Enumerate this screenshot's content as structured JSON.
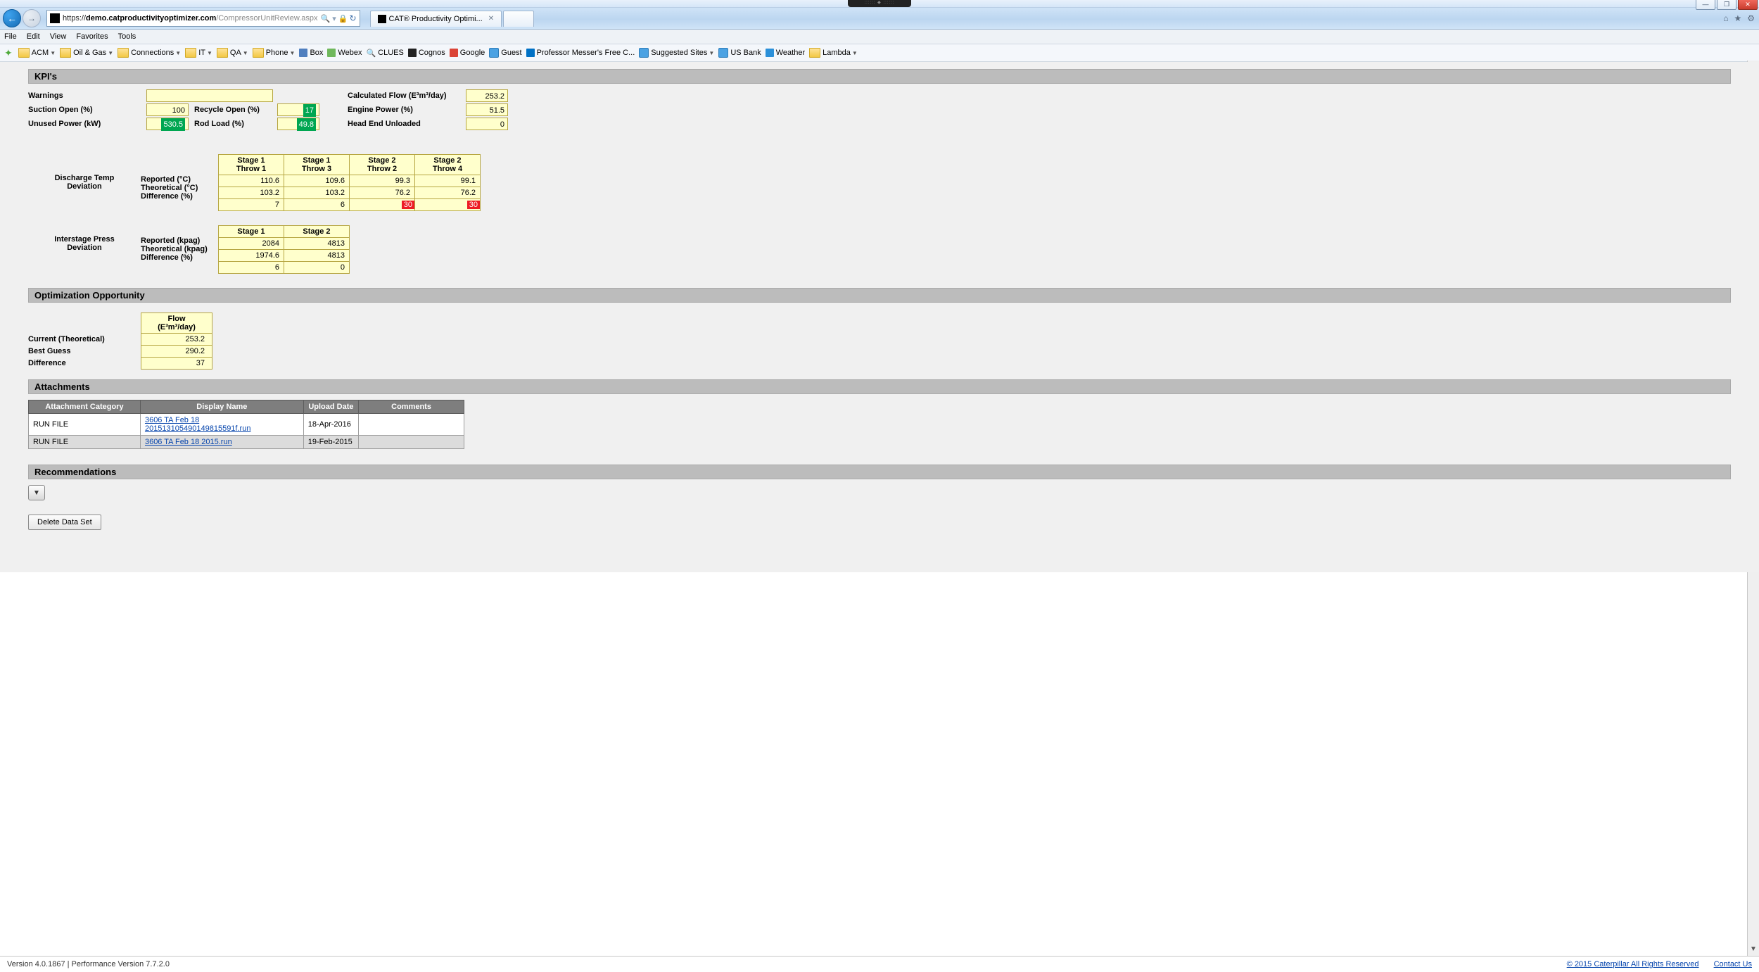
{
  "window": {
    "tab_title": "CAT® Productivity Optimi...",
    "url_host": "demo.catproductivityoptimizer.com",
    "url_path": "/CompressorUnitReview.aspx",
    "url_scheme": "https://"
  },
  "menubar": [
    "File",
    "Edit",
    "View",
    "Favorites",
    "Tools"
  ],
  "bookmarks": {
    "folders": [
      "ACM",
      "Oil & Gas",
      "Connections",
      "IT",
      "QA",
      "Phone"
    ],
    "items": [
      "Box",
      "Webex",
      "CLUES",
      "Cognos",
      "Google",
      "Guest",
      "Professor Messer's Free C...",
      "Suggested Sites",
      "US Bank",
      "Weather",
      "Lambda"
    ]
  },
  "sections": {
    "kpis": "KPI's",
    "opt": "Optimization Opportunity",
    "att": "Attachments",
    "rec": "Recommendations"
  },
  "kpi": {
    "labels": {
      "warnings": "Warnings",
      "suction_open": "Suction Open (%)",
      "unused_power": "Unused Power (kW)",
      "recycle_open": "Recycle Open (%)",
      "rod_load": "Rod Load (%)",
      "calc_flow": "Calculated Flow (E³m³/day)",
      "engine_power": "Engine Power (%)",
      "head_end": "Head End Unloaded"
    },
    "values": {
      "warnings": "",
      "suction_open": "100",
      "unused_power": "530.5",
      "recycle_open": "17",
      "rod_load": "49.8",
      "calc_flow": "253.2",
      "engine_power": "51.5",
      "head_end": "0"
    }
  },
  "discharge": {
    "title1": "Discharge Temp",
    "title2": "Deviation",
    "rows": [
      "Reported (°C)",
      "Theoretical (°C)",
      "Difference (%)"
    ],
    "headers": [
      {
        "l1": "Stage 1",
        "l2": "Throw 1"
      },
      {
        "l1": "Stage 1",
        "l2": "Throw 3"
      },
      {
        "l1": "Stage 2",
        "l2": "Throw 2"
      },
      {
        "l1": "Stage 2",
        "l2": "Throw 4"
      }
    ],
    "data": [
      [
        "110.6",
        "109.6",
        "99.3",
        "99.1"
      ],
      [
        "103.2",
        "103.2",
        "76.2",
        "76.2"
      ],
      [
        "7",
        "6",
        "30",
        "30"
      ]
    ],
    "diff_flags": [
      false,
      false,
      true,
      true
    ]
  },
  "interstage": {
    "title1": "Interstage Press",
    "title2": "Deviation",
    "rows": [
      "Reported (kpag)",
      "Theoretical (kpag)",
      "Difference (%)"
    ],
    "headers": [
      "Stage 1",
      "Stage 2"
    ],
    "data": [
      [
        "2084",
        "4813"
      ],
      [
        "1974.6",
        "4813"
      ],
      [
        "6",
        "0"
      ]
    ]
  },
  "opt": {
    "header1": "Flow",
    "header2": "(E³m³/day)",
    "labels": [
      "Current (Theoretical)",
      "Best Guess",
      "Difference"
    ],
    "values": [
      "253.2",
      "290.2",
      "37"
    ]
  },
  "att": {
    "headers": [
      "Attachment Category",
      "Display Name",
      "Upload Date",
      "Comments"
    ],
    "rows": [
      {
        "cat": "RUN FILE",
        "name": "3606 TA Feb 18 201513105490149815591f.run",
        "date": "18-Apr-2016",
        "comments": ""
      },
      {
        "cat": "RUN FILE",
        "name": "3606 TA Feb 18 2015.run",
        "date": "19-Feb-2015",
        "comments": ""
      }
    ]
  },
  "buttons": {
    "delete": "Delete Data Set"
  },
  "footer": {
    "version": "Version 4.0.1867 | Performance Version 7.7.2.0",
    "copyright": "© 2015 Caterpillar All Rights Reserved",
    "contact": "Contact Us"
  }
}
